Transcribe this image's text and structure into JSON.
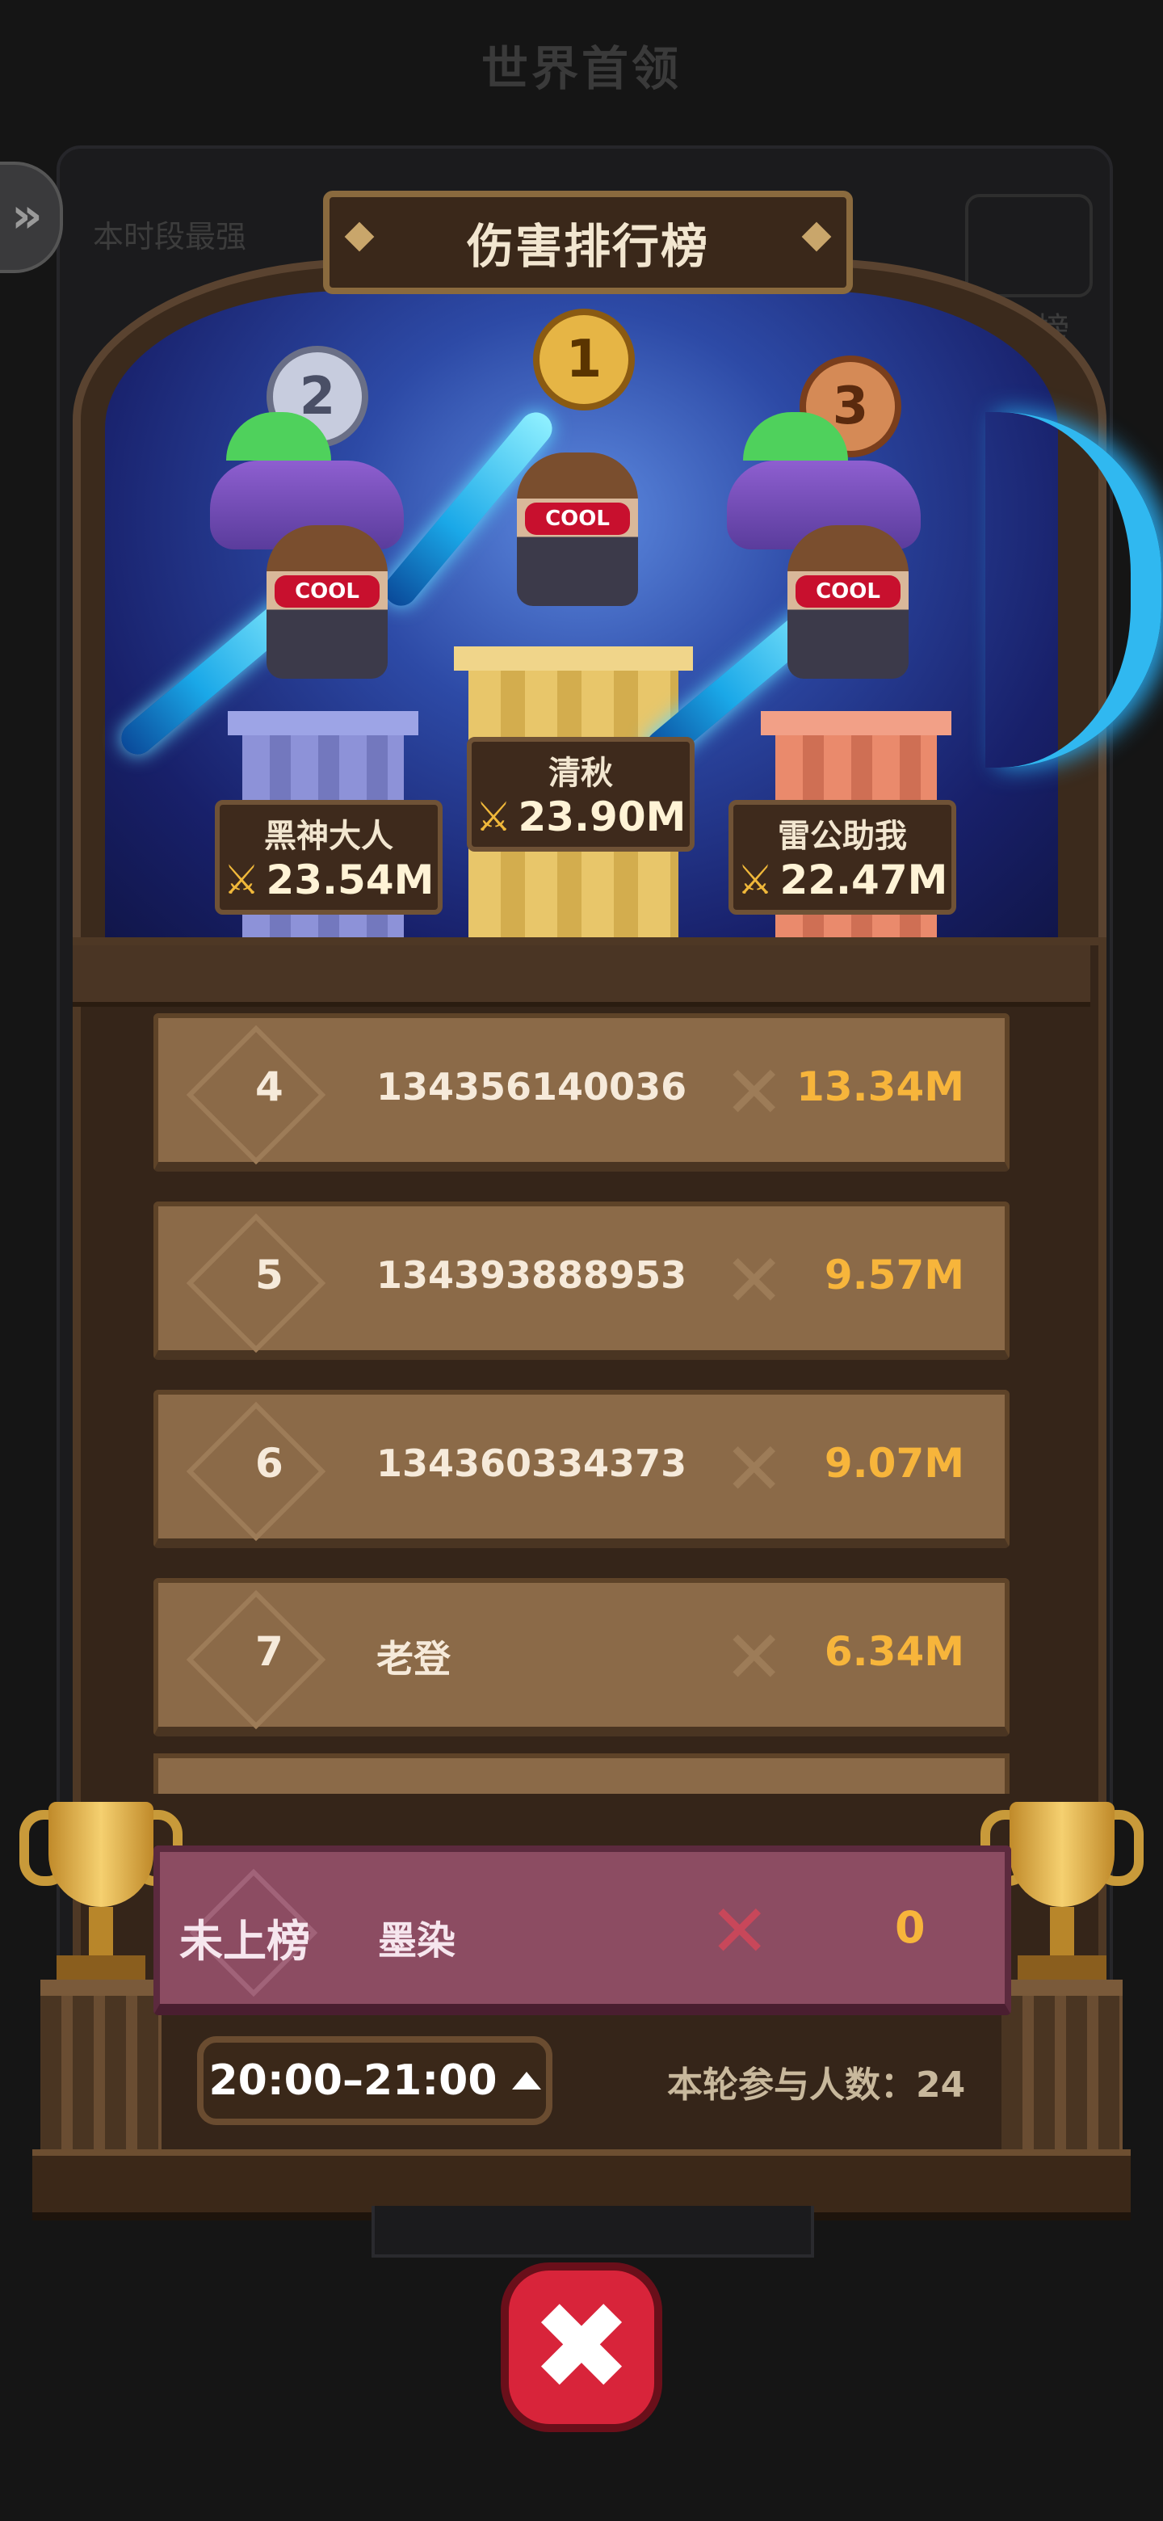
{
  "background": {
    "title": "世界首领",
    "hint": "本时段最强",
    "rank_label": "行榜"
  },
  "header": {
    "title": "伤害排行榜"
  },
  "podium": [
    {
      "rank": "1",
      "name": "清秋",
      "damage": "23.90M",
      "color": "#e6b545"
    },
    {
      "rank": "2",
      "name": "黑神大人",
      "damage": "23.54M",
      "color": "#c7ccde"
    },
    {
      "rank": "3",
      "name": "雷公助我",
      "damage": "22.47M",
      "color": "#d58a56"
    }
  ],
  "hero_badge": "COOL",
  "rows": [
    {
      "rank": "4",
      "name": "134356140036",
      "damage": "13.34M"
    },
    {
      "rank": "5",
      "name": "134393888953",
      "damage": "9.57M"
    },
    {
      "rank": "6",
      "name": "134360334373",
      "damage": "9.07M"
    },
    {
      "rank": "7",
      "name": "老登",
      "damage": "6.34M"
    }
  ],
  "my_row": {
    "rank": "未上榜",
    "name": "墨染",
    "damage": "0"
  },
  "footer": {
    "time_slot": "20:00–21:00",
    "participants": "本轮参与人数：24"
  },
  "icons": {
    "sword": "crossed-swords-icon",
    "close": "close-icon",
    "side": "double-chevron-icon"
  },
  "colors": {
    "damage": "#f7b53b",
    "row_bg": "#8b6a48",
    "my_row_bg": "#8c4c62",
    "close_button": "#d8243a"
  }
}
